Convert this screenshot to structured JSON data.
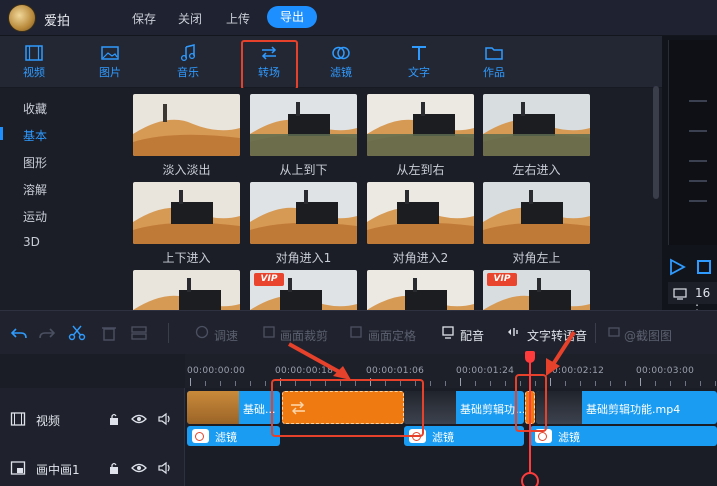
{
  "app": {
    "name": "爱拍"
  },
  "topmenu": {
    "save": "保存",
    "close": "关闭",
    "upload": "上传",
    "export": "导出"
  },
  "categories": [
    {
      "label": "视频",
      "icon": "film-icon"
    },
    {
      "label": "图片",
      "icon": "image-icon"
    },
    {
      "label": "音乐",
      "icon": "music-note-icon"
    },
    {
      "label": "转场",
      "icon": "swap-arrows-icon",
      "active": true
    },
    {
      "label": "滤镜",
      "icon": "overlap-circles-icon"
    },
    {
      "label": "文字",
      "icon": "text-t-icon"
    },
    {
      "label": "作品",
      "icon": "folder-icon"
    }
  ],
  "sidebar": {
    "items": [
      "收藏",
      "基本",
      "图形",
      "溶解",
      "运动",
      "3D"
    ],
    "selected": "基本"
  },
  "transitions": [
    {
      "label": "淡入淡出",
      "vip": false
    },
    {
      "label": "从上到下",
      "vip": false
    },
    {
      "label": "从左到右",
      "vip": false
    },
    {
      "label": "左右进入",
      "vip": false
    },
    {
      "label": "上下进入",
      "vip": false
    },
    {
      "label": "对角进入1",
      "vip": false
    },
    {
      "label": "对角进入2",
      "vip": false
    },
    {
      "label": "对角左上",
      "vip": false
    },
    {
      "label": "",
      "vip": false
    },
    {
      "label": "",
      "vip": true
    },
    {
      "label": "",
      "vip": false
    },
    {
      "label": "",
      "vip": true
    }
  ],
  "vip_badge": "VIP",
  "preview": {
    "time": "16 :"
  },
  "edit_toolbar": {
    "speed": "调速",
    "crop": "画面裁剪",
    "position": "画面定格",
    "dub": "配音",
    "tts": "文字转语音",
    "screenshot": "@截图图"
  },
  "timeline": {
    "ticks": [
      "00:00:00:00",
      "00:00:00:18",
      "00:00:01:06",
      "00:00:01:24",
      "00:00:02:12",
      "00:00:03:00"
    ],
    "tracks": [
      {
        "label": "视频",
        "icon": "film-icon"
      },
      {
        "label": "画中画1",
        "icon": "picture-in-picture-icon"
      }
    ],
    "clips": [
      {
        "text": "基础..."
      },
      {
        "text": "基础剪辑功..."
      },
      {
        "text": "基础剪辑功能.mp4"
      }
    ],
    "filter_label": "滤镜"
  },
  "colors": {
    "accent": "#1e8fff",
    "highlight": "#e5412b",
    "clip_orange": "#f07a12",
    "filter_blue": "#1a9cf2"
  }
}
